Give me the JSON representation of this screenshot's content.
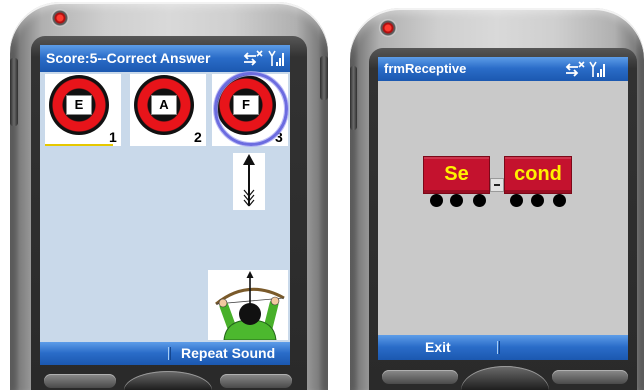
{
  "colors": {
    "titlebar_top": "#5d9de8",
    "titlebar_bottom": "#1b58b0",
    "left_content_bg": "#c9d9ea",
    "right_content_bg": "#c9c9c9",
    "target_red": "#e8141a",
    "selection_ring": "#6c6ce0",
    "focus_underline": "#e6c800",
    "train_red": "#c4122e",
    "train_text": "#fff200"
  },
  "left_phone": {
    "title": "Score:5--Correct Answer",
    "status_icons": [
      "connection-off-icon",
      "signal-strength-icon"
    ],
    "targets": [
      {
        "letter": "E",
        "number": "1",
        "selected": false,
        "focused": true
      },
      {
        "letter": "A",
        "number": "2",
        "selected": false,
        "focused": false
      },
      {
        "letter": "F",
        "number": "3",
        "selected": true,
        "focused": false
      }
    ],
    "pictures": [
      "arrow-icon",
      "archer-icon"
    ],
    "softkeys": {
      "right": "Repeat Sound"
    }
  },
  "right_phone": {
    "title": "frmReceptive",
    "status_icons": [
      "connection-off-icon",
      "signal-strength-icon"
    ],
    "train_cars": [
      "Se",
      "cond"
    ],
    "softkeys": {
      "left": "Exit"
    }
  }
}
